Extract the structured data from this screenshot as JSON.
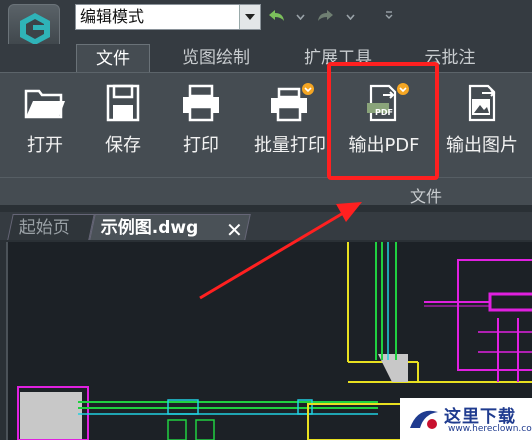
{
  "toolbar": {
    "mode_select_value": "编辑模式"
  },
  "menu_tabs": [
    {
      "label": "文件",
      "active": true
    },
    {
      "label": "览图绘制",
      "active": false
    },
    {
      "label": "扩展工具",
      "active": false
    },
    {
      "label": "云批注",
      "active": false
    }
  ],
  "ribbon": {
    "buttons": [
      {
        "label": "打开",
        "icon": "folder-open-icon"
      },
      {
        "label": "保存",
        "icon": "floppy-disk-icon"
      },
      {
        "label": "打印",
        "icon": "printer-icon"
      },
      {
        "label": "批量打印",
        "icon": "batch-print-icon"
      },
      {
        "label": "输出PDF",
        "icon": "pdf-export-icon",
        "badge_text": "PDF"
      },
      {
        "label": "输出图片",
        "icon": "image-export-icon"
      }
    ],
    "group_label": "文件"
  },
  "doc_tabs": [
    {
      "label": "起始页",
      "active": false
    },
    {
      "label": "示例图.dwg",
      "active": true
    }
  ],
  "watermark": {
    "text": "这里下载",
    "url": "www.hereclown.com"
  },
  "colors": {
    "highlight": "#ff2020",
    "drawing_magenta": "#e020e0",
    "drawing_green": "#20d040",
    "drawing_yellow": "#e8e020",
    "drawing_cyan": "#20d0e0"
  }
}
